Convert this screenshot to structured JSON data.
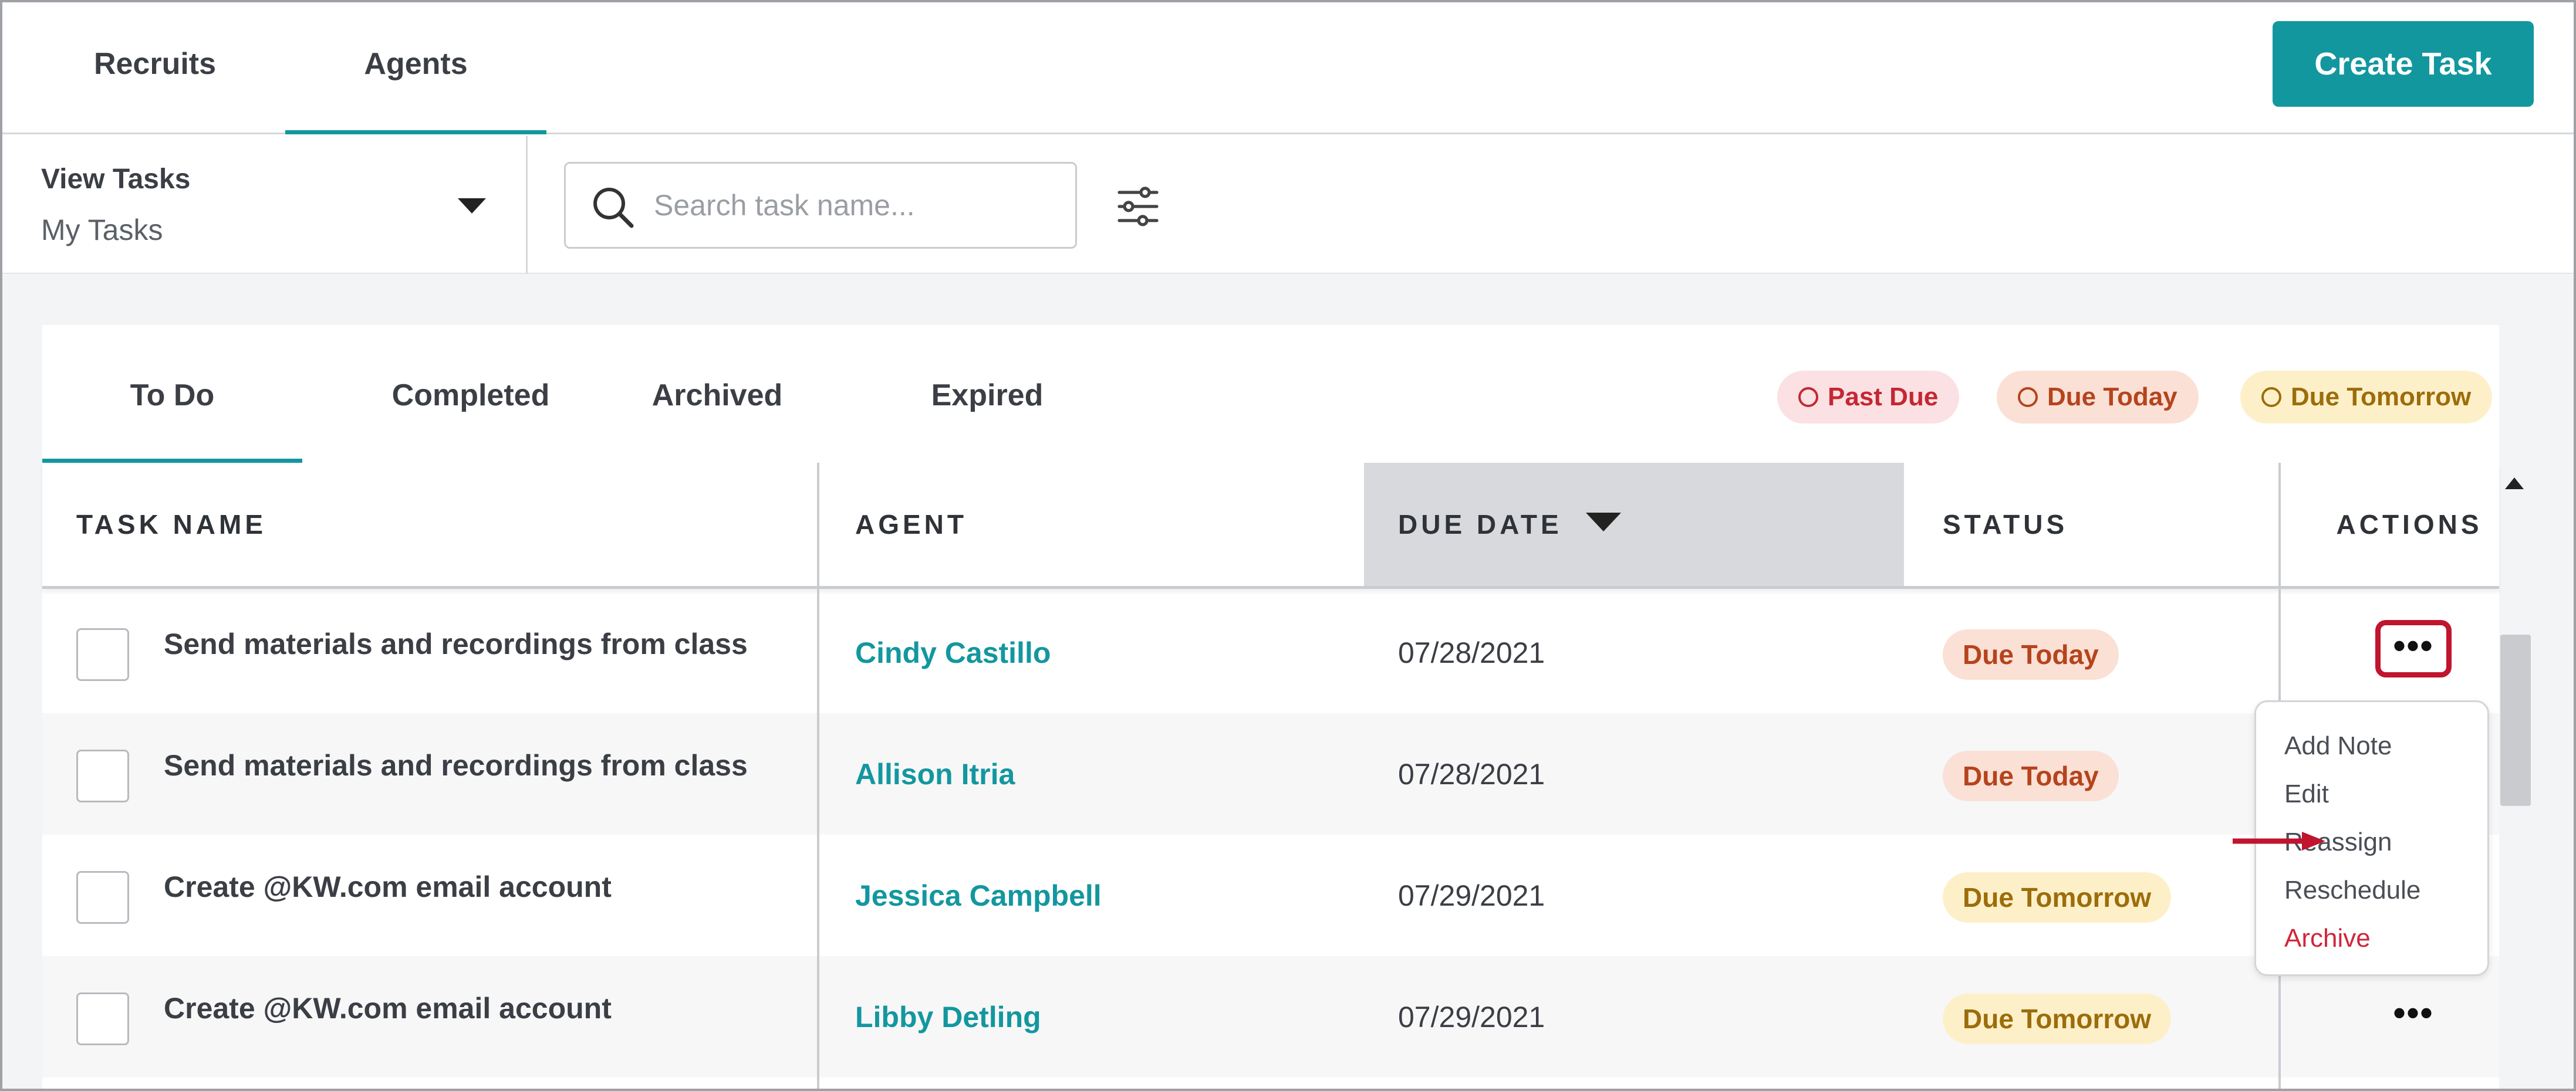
{
  "top_tabs": {
    "recruits": "Recruits",
    "agents": "Agents"
  },
  "create_task_label": "Create Task",
  "view_tasks": {
    "label": "View Tasks",
    "value": "My Tasks"
  },
  "search": {
    "placeholder": "Search task name..."
  },
  "sub_tabs": {
    "todo": "To Do",
    "completed": "Completed",
    "archived": "Archived",
    "expired": "Expired"
  },
  "legend": {
    "past_due": "Past Due",
    "due_today": "Due Today",
    "due_tomorrow": "Due Tomorrow"
  },
  "columns": {
    "task_name": "TASK NAME",
    "agent": "AGENT",
    "due_date": "DUE DATE",
    "status": "STATUS",
    "actions": "ACTIONS"
  },
  "rows": [
    {
      "task": "Send materials and recordings from class",
      "agent": "Cindy Castillo",
      "due": "07/28/2021",
      "status": "Due Today",
      "actions": "•••"
    },
    {
      "task": "Send materials and recordings from class",
      "agent": "Allison Itria",
      "due": "07/28/2021",
      "status": "Due Today",
      "actions": "•••"
    },
    {
      "task": "Create @KW.com email account",
      "agent": "Jessica Campbell",
      "due": "07/29/2021",
      "status": "Due Tomorrow",
      "actions": "•••"
    },
    {
      "task": "Create @KW.com email account",
      "agent": "Libby Detling",
      "due": "07/29/2021",
      "status": "Due Tomorrow",
      "actions": "•••"
    }
  ],
  "actions_menu": {
    "add_note": "Add Note",
    "edit": "Edit",
    "reassign": "Reassign",
    "reschedule": "Reschedule",
    "archive": "Archive"
  },
  "colors": {
    "accent": "#13979f",
    "highlight": "#c0142f",
    "due_today_bg": "#fbe0d6",
    "due_tomorrow_bg": "#fdf0c9",
    "past_due_bg": "#fbe1e3"
  }
}
